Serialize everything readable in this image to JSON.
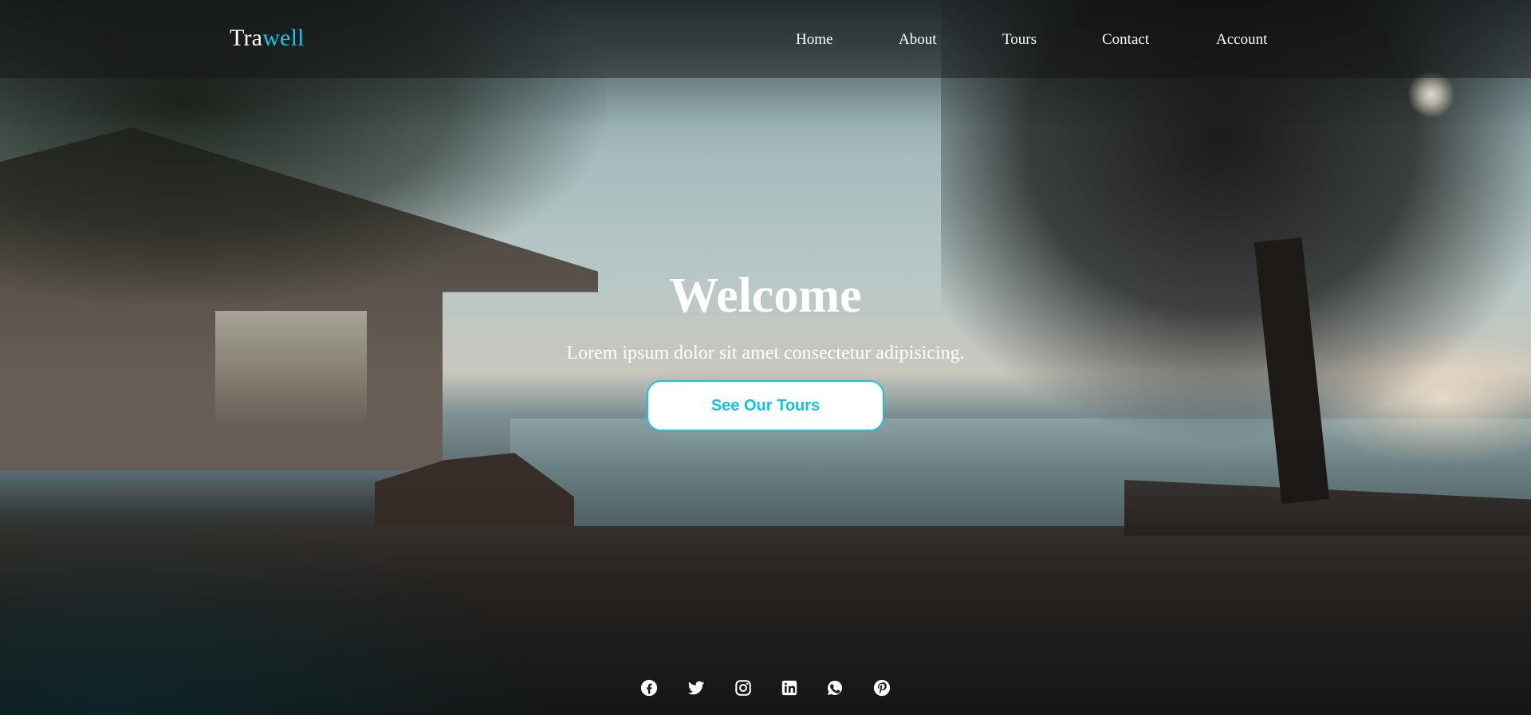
{
  "brand": {
    "part1": "Tra",
    "part2": "well",
    "accent_color": "#18c3e8"
  },
  "nav": {
    "items": [
      {
        "label": "Home"
      },
      {
        "label": "About"
      },
      {
        "label": "Tours"
      },
      {
        "label": "Contact"
      },
      {
        "label": "Account"
      }
    ]
  },
  "hero": {
    "title": "Welcome",
    "subtitle": "Lorem ipsum dolor sit amet consectetur adipisicing.",
    "cta_label": "See Our Tours"
  },
  "social": {
    "icons": [
      "facebook-icon",
      "twitter-icon",
      "instagram-icon",
      "linkedin-icon",
      "whatsapp-icon",
      "pinterest-icon"
    ]
  },
  "colors": {
    "accent": "#18c3e8",
    "text": "#ffffff",
    "button_bg": "#ffffff"
  }
}
